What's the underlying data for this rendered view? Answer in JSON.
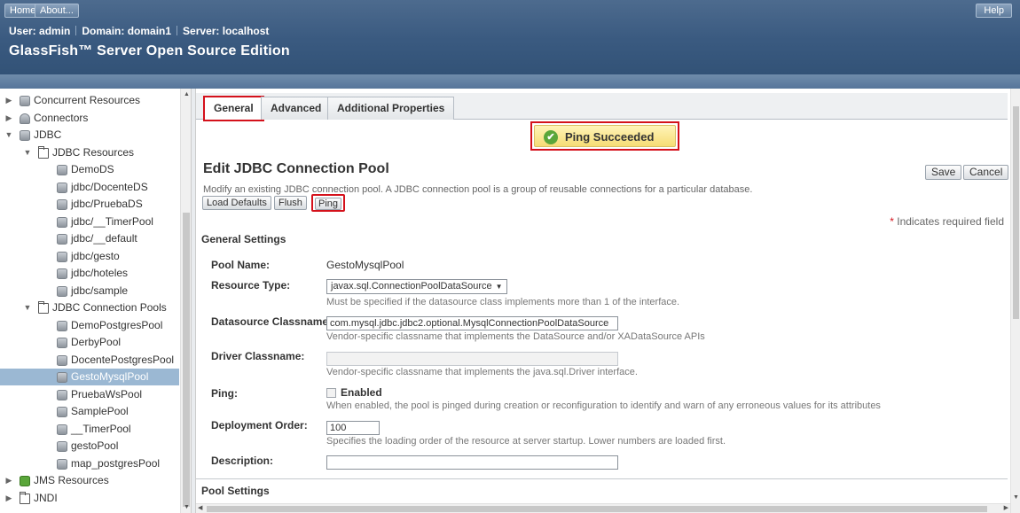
{
  "masthead": {
    "home_label": "Home",
    "about_label": "About...",
    "help_label": "Help",
    "user_line": {
      "user": "User: admin",
      "domain": "Domain: domain1",
      "server": "Server: localhost"
    },
    "product_name": "GlassFish™ Server Open Source Edition"
  },
  "tree": {
    "items": [
      {
        "label": "Concurrent Resources",
        "toggle": "▶",
        "icon": "database-icon"
      },
      {
        "label": "Connectors",
        "toggle": "▶",
        "icon": "connector-icon"
      },
      {
        "label": "JDBC",
        "toggle": "▼",
        "icon": "database-icon"
      },
      {
        "label": "JDBC Resources",
        "toggle": "▼",
        "icon": "folder-icon"
      },
      {
        "label": "DemoDS",
        "icon": "database-icon"
      },
      {
        "label": "jdbc/DocenteDS",
        "icon": "database-icon"
      },
      {
        "label": "jdbc/PruebaDS",
        "icon": "database-icon"
      },
      {
        "label": "jdbc/__TimerPool",
        "icon": "database-icon"
      },
      {
        "label": "jdbc/__default",
        "icon": "database-icon"
      },
      {
        "label": "jdbc/gesto",
        "icon": "database-icon"
      },
      {
        "label": "jdbc/hoteles",
        "icon": "database-icon"
      },
      {
        "label": "jdbc/sample",
        "icon": "database-icon"
      },
      {
        "label": "JDBC Connection Pools",
        "toggle": "▼",
        "icon": "folder-icon"
      },
      {
        "label": "DemoPostgresPool",
        "icon": "database-icon"
      },
      {
        "label": "DerbyPool",
        "icon": "database-icon"
      },
      {
        "label": "DocentePostgresPool",
        "icon": "database-icon"
      },
      {
        "label": "GestoMysqlPool",
        "icon": "database-icon",
        "selected": true
      },
      {
        "label": "PruebaWsPool",
        "icon": "database-icon"
      },
      {
        "label": "SamplePool",
        "icon": "database-icon"
      },
      {
        "label": "__TimerPool",
        "icon": "database-icon"
      },
      {
        "label": "gestoPool",
        "icon": "database-icon"
      },
      {
        "label": "map_postgresPool",
        "icon": "database-icon"
      },
      {
        "label": "JMS Resources",
        "toggle": "▶",
        "icon": "jms-icon"
      },
      {
        "label": "JNDI",
        "toggle": "▶",
        "icon": "folder-icon"
      }
    ]
  },
  "tabs": {
    "general": "General",
    "advanced": "Advanced",
    "additional": "Additional Properties"
  },
  "message": {
    "text": "Ping Succeeded"
  },
  "page": {
    "title": "Edit JDBC Connection Pool",
    "help": "Modify an existing JDBC connection pool. A JDBC connection pool is a group of reusable connections for a particular database.",
    "save_label": "Save",
    "cancel_label": "Cancel",
    "load_defaults_label": "Load Defaults",
    "flush_label": "Flush",
    "ping_label": "Ping",
    "required_note": "Indicates required field",
    "required_star": "*"
  },
  "general_settings": {
    "title": "General Settings",
    "pool_name_label": "Pool Name:",
    "pool_name_value": "GestoMysqlPool",
    "resource_type_label": "Resource Type:",
    "resource_type_value": "javax.sql.ConnectionPoolDataSource",
    "resource_type_help": "Must be specified if the datasource class implements more than 1 of the interface.",
    "ds_classname_label": "Datasource Classname:",
    "ds_classname_value": "com.mysql.jdbc.jdbc2.optional.MysqlConnectionPoolDataSource",
    "ds_classname_help": "Vendor-specific classname that implements the DataSource and/or XADataSource APIs",
    "driver_classname_label": "Driver Classname:",
    "driver_classname_value": "",
    "driver_classname_help": "Vendor-specific classname that implements the java.sql.Driver interface.",
    "ping_label": "Ping:",
    "ping_enabled_label": "Enabled",
    "ping_help": "When enabled, the pool is pinged during creation or reconfiguration to identify and warn of any erroneous values for its attributes",
    "deploy_order_label": "Deployment Order:",
    "deploy_order_value": "100",
    "deploy_order_help": "Specifies the loading order of the resource at server startup. Lower numbers are loaded first.",
    "description_label": "Description:",
    "description_value": ""
  },
  "pool_settings": {
    "title": "Pool Settings"
  },
  "colors": {
    "masthead": "#3a5a80",
    "highlight_outline": "#d4111b",
    "selected_tree_row": "#9bb8d3",
    "success_bg": "#f6dd75",
    "success_icon": "#5aa63a"
  }
}
